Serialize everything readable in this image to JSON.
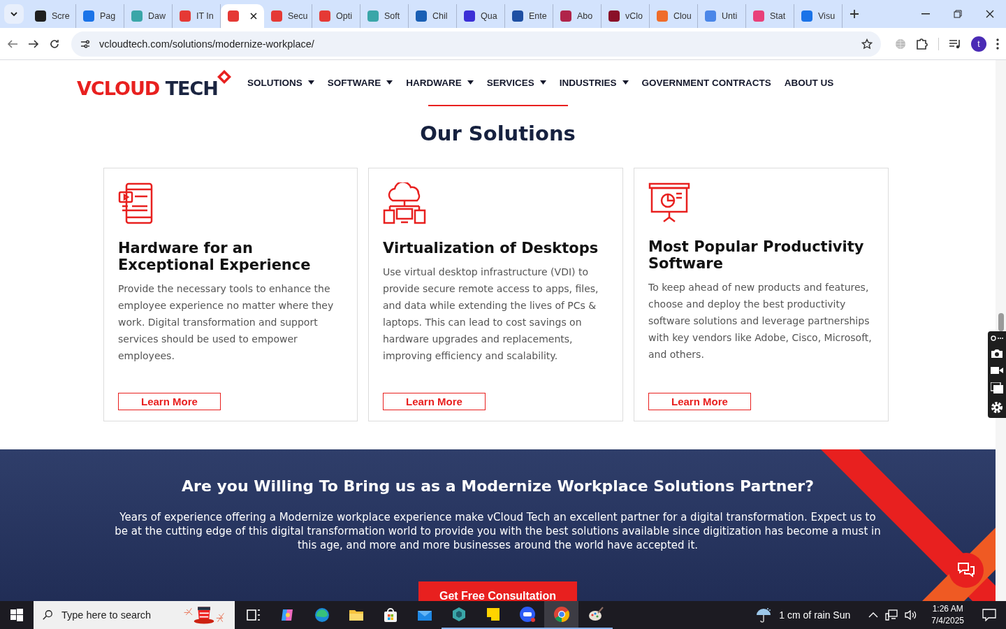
{
  "tabs": [
    {
      "title": "Scre",
      "color": "#1f1f1f",
      "selected": false
    },
    {
      "title": "Pag",
      "color": "#1a73e8",
      "selected": false
    },
    {
      "title": "Daw",
      "color": "#3aa6a8",
      "selected": false
    },
    {
      "title": "IT In",
      "color": "#e53935",
      "selected": false
    },
    {
      "color": "#e53935",
      "selected": true
    },
    {
      "title": "Secu",
      "color": "#e53935",
      "selected": false
    },
    {
      "title": "Opti",
      "color": "#e53935",
      "selected": false
    },
    {
      "title": "Soft",
      "color": "#3aa6a8",
      "selected": false
    },
    {
      "title": "Chil",
      "color": "#1a5fb4",
      "selected": false
    },
    {
      "title": "Qua",
      "color": "#3b2fd6",
      "selected": false
    },
    {
      "title": "Ente",
      "color": "#1e4fa3",
      "selected": false
    },
    {
      "title": "Abo",
      "color": "#b0244a",
      "selected": false
    },
    {
      "title": "vClo",
      "color": "#8a1028",
      "selected": false
    },
    {
      "title": "Clou",
      "color": "#ef6c2a",
      "selected": false
    },
    {
      "title": "Unti",
      "color": "#4a86e8",
      "selected": false
    },
    {
      "title": "Stat",
      "color": "#e8407a",
      "selected": false
    },
    {
      "title": "Visu",
      "color": "#1a73e8",
      "selected": false
    }
  ],
  "address_bar": {
    "url": "vcloudtech.com/solutions/modernize-workplace/",
    "avatar": "t"
  },
  "site": {
    "logo": {
      "part1": "VCLOUD",
      "part2": "TECH"
    },
    "nav": [
      {
        "label": "SOLUTIONS",
        "has_menu": true
      },
      {
        "label": "SOFTWARE",
        "has_menu": true
      },
      {
        "label": "HARDWARE",
        "has_menu": true
      },
      {
        "label": "SERVICES",
        "has_menu": true
      },
      {
        "label": "INDUSTRIES",
        "has_menu": true
      },
      {
        "label": "GOVERNMENT CONTRACTS",
        "has_menu": false
      },
      {
        "label": "ABOUT US",
        "has_menu": false
      }
    ],
    "section_title": "Our Solutions",
    "cards": [
      {
        "kind": "tablet",
        "title": "Hardware for an Exceptional Experience",
        "text": "Provide the necessary tools to enhance the employee experience no matter where they work. Digital transformation and support services should be used to empower employees.",
        "button": "Learn More"
      },
      {
        "kind": "cloud",
        "title": "Virtualization of Desktops",
        "text": "Use virtual desktop infrastructure (VDI) to provide secure remote access to apps, files, and data while extending the lives of PCs & laptops. This can lead to cost savings on hardware upgrades and replacements, improving efficiency and scalability.",
        "button": "Learn More"
      },
      {
        "kind": "presentation",
        "title": "Most Popular Productivity Software",
        "text": "To keep ahead of new products and features, choose and deploy the best productivity software solutions and leverage partnerships with key vendors like Adobe, Cisco, Microsoft, and others.",
        "button": "Learn More"
      }
    ],
    "banner": {
      "title": "Are you Willing To Bring us as a Modernize Workplace Solutions Partner?",
      "text": "Years of experience offering a Modernize workplace experience make vCloud Tech an excellent partner for a digital transformation. Expect us to be at the cutting edge of this digital transformation world to provide you with the best solutions available since digitization has become a must in this age, and more and more businesses around the world have accepted it.",
      "button": "Get Free Consultation"
    }
  },
  "taskbar": {
    "search_placeholder": "Type here to search",
    "apps": [
      {
        "kind": "taskview",
        "running": false,
        "selected": false
      },
      {
        "kind": "copilot",
        "running": false,
        "selected": false
      },
      {
        "kind": "edge",
        "running": false,
        "selected": false
      },
      {
        "kind": "folder",
        "running": false,
        "selected": false
      },
      {
        "kind": "store",
        "running": false,
        "selected": false
      },
      {
        "kind": "mail",
        "running": false,
        "selected": false
      },
      {
        "kind": "hexagon",
        "running": true,
        "selected": false
      },
      {
        "kind": "note",
        "running": true,
        "selected": false
      },
      {
        "kind": "zoom",
        "running": true,
        "selected": false
      },
      {
        "kind": "chrome",
        "running": true,
        "selected": true
      },
      {
        "kind": "palette",
        "running": true,
        "selected": false
      }
    ],
    "weather": "1 cm of rain Sun",
    "time": "1:26 AM",
    "date": "7/4/2025"
  }
}
